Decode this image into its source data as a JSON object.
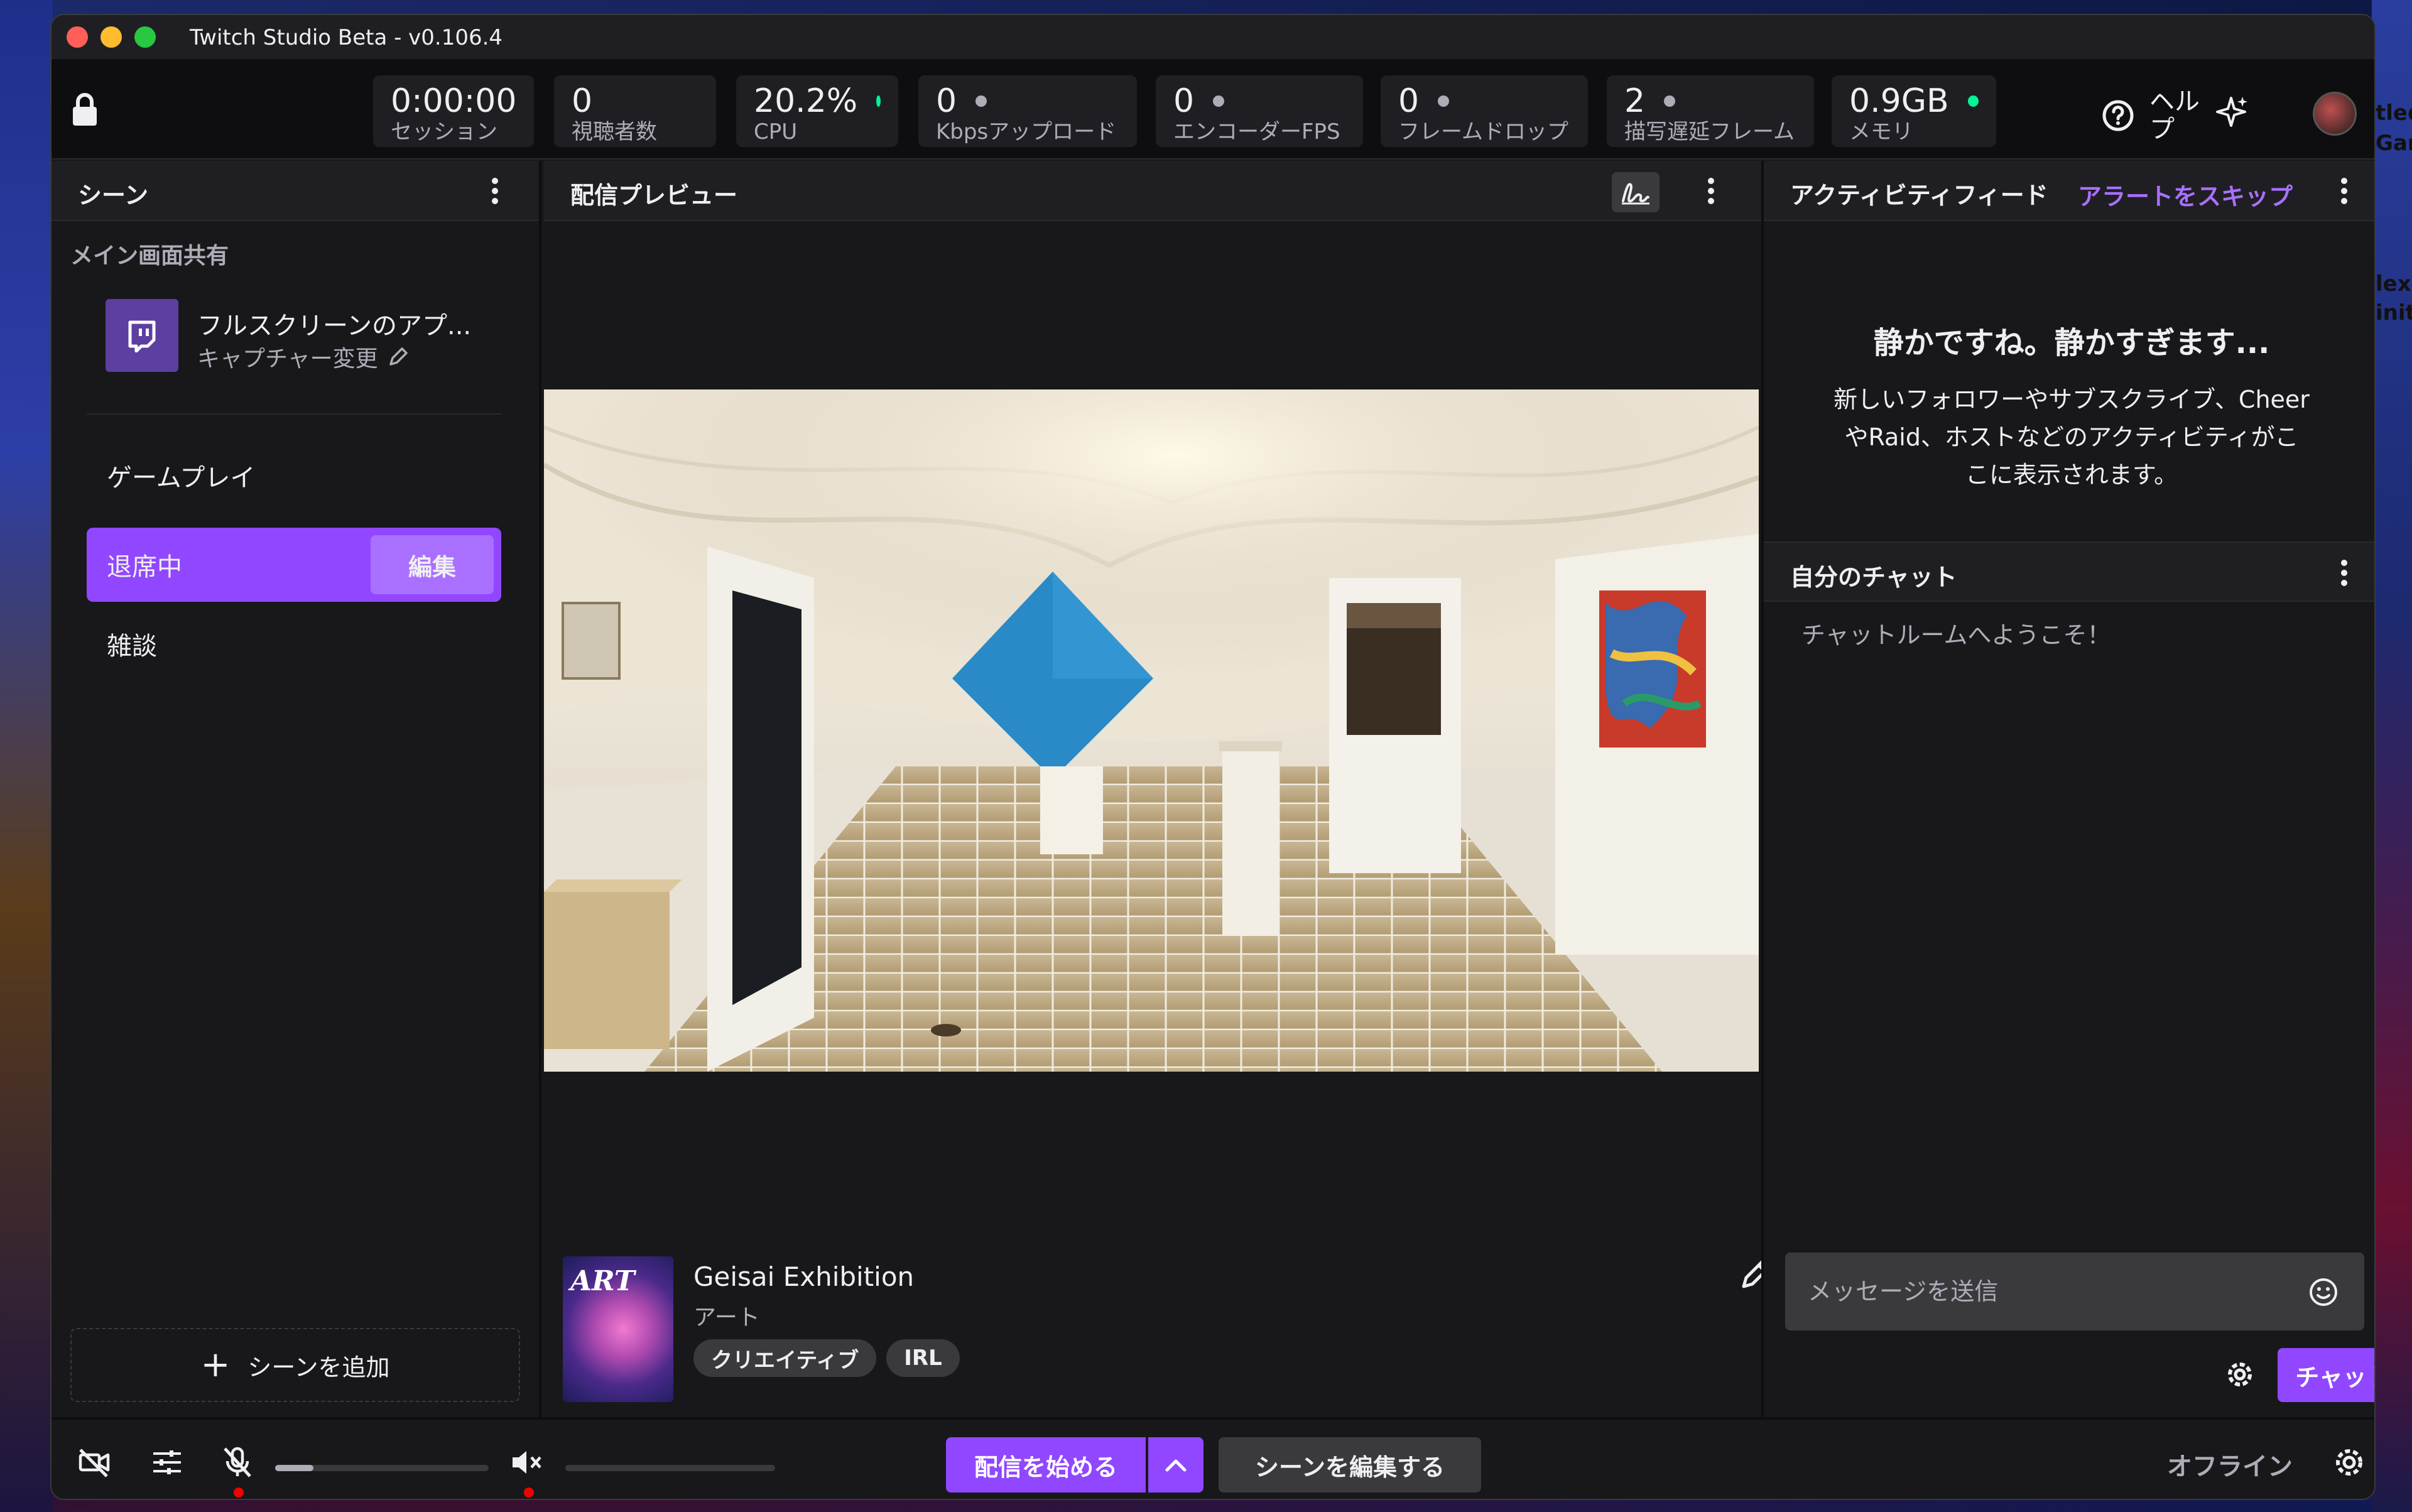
{
  "desktop": {
    "right_fragments": [
      "tled",
      "Gan",
      "lexo",
      "init"
    ]
  },
  "window": {
    "title": "Twitch Studio Beta - v0.106.4"
  },
  "stats": [
    {
      "value": "0:00:00",
      "label": "セッション",
      "dot": ""
    },
    {
      "value": "0",
      "label": "視聴者数",
      "dot": ""
    },
    {
      "value": "20.2%",
      "label": "CPU",
      "dot": "green"
    },
    {
      "value": "0",
      "label": "Kbpsアップロード",
      "dot": "gray"
    },
    {
      "value": "0",
      "label": "エンコーダーFPS",
      "dot": "gray"
    },
    {
      "value": "0",
      "label": "フレームドロップ",
      "dot": "gray"
    },
    {
      "value": "2",
      "label": "描写遅延フレーム",
      "dot": "gray"
    },
    {
      "value": "0.9GB",
      "label": "メモリ",
      "dot": "green"
    }
  ],
  "toolbar": {
    "help_label": "ヘルプ"
  },
  "scenes_panel": {
    "title": "シーン",
    "section_label": "メイン画面共有",
    "source_name": "フルスクリーンのアプ...",
    "source_action": "キャプチャー変更",
    "scenes": [
      {
        "name": "ゲームプレイ",
        "active": false
      },
      {
        "name": "退席中",
        "active": true
      },
      {
        "name": "雑談",
        "active": false
      }
    ],
    "edit_label": "編集",
    "add_scene_label": "シーンを追加"
  },
  "preview_panel": {
    "title": "配信プレビュー",
    "stream_title": "Geisai Exhibition",
    "category": "アート",
    "tags": [
      "クリエイティブ",
      "IRL"
    ],
    "thumbnail_text": "ART"
  },
  "activity_panel": {
    "title": "アクティビティフィード",
    "skip_alerts": "アラートをスキップ",
    "empty_title": "静かですね。静かすぎます...",
    "empty_text": "新しいフォロワーやサブスクライブ、CheerやRaid、ホストなどのアクティビティがここに表示されます。"
  },
  "chat_panel": {
    "title": "自分のチャット",
    "welcome": "チャットルームへようこそ！",
    "input_placeholder": "メッセージを送信",
    "chat_button": "チャット"
  },
  "bottom_bar": {
    "go_live": "配信を始める",
    "edit_scenes": "シーンを編集する",
    "status": "オフライン",
    "mic_level": 0.18,
    "desktop_audio_level": 0
  },
  "colors": {
    "accent": "#9147ff",
    "accent_light": "#a970ff",
    "status_green": "#00f593",
    "muted_red": "#eb0400"
  }
}
